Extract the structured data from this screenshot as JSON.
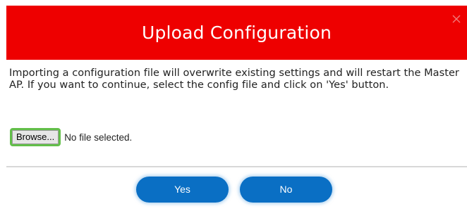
{
  "dialog": {
    "title": "Upload Configuration",
    "close_icon": "close-icon",
    "message": "Importing a configuration file will overwrite existing settings and will restart the Master AP. If you want to continue, select the config file and click on 'Yes' button.",
    "browse_label": "Browse...",
    "file_status": "No file selected.",
    "yes_label": "Yes",
    "no_label": "No"
  },
  "colors": {
    "header_bg": "#ee0000",
    "primary_button": "#0a6fc4",
    "focus_ring": "#63bf4a",
    "divider": "#d8d8d8"
  }
}
